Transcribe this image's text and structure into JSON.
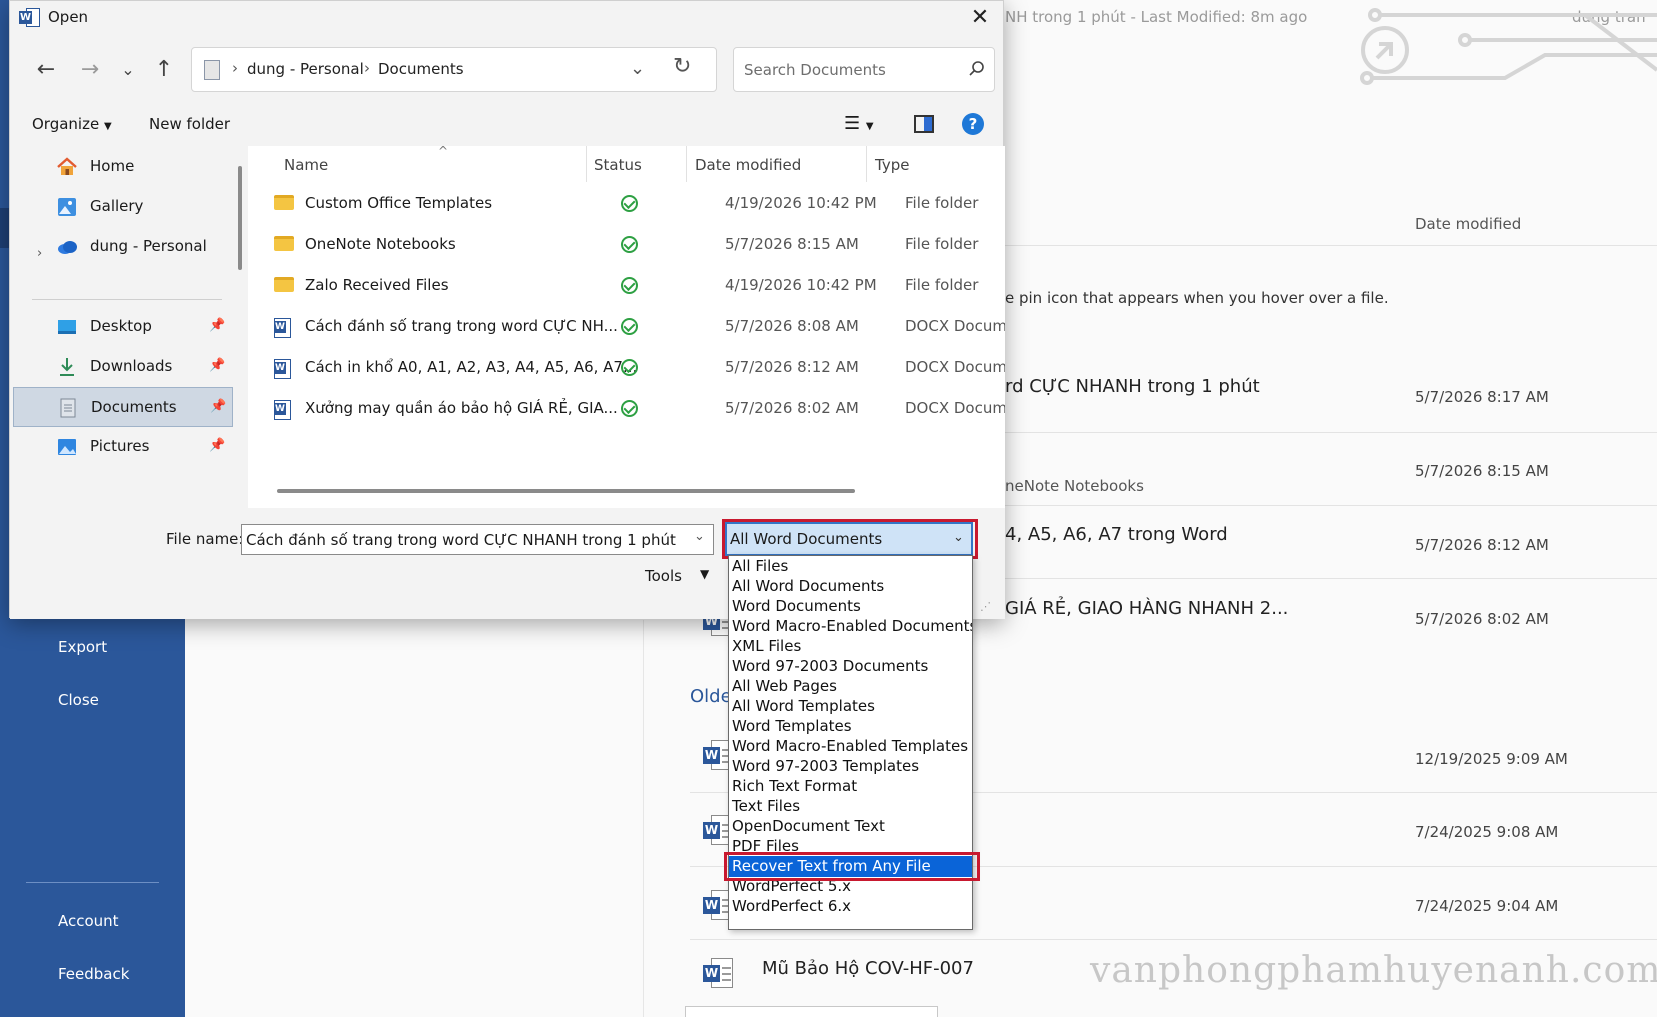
{
  "backstage": {
    "window_title": "NH trong 1 phút  -  Last Modified: 8m ago",
    "user": "dung tran",
    "nav": {
      "export": "Export",
      "close": "Close",
      "account": "Account",
      "feedback": "Feedback"
    },
    "list_header_date": "Date modified",
    "pin_hint": "e pin icon that appears when you hover over a file.",
    "rows": [
      {
        "title": "rd CỰC NHANH trong 1 phút",
        "sub": "",
        "date": "5/7/2026 8:17 AM"
      },
      {
        "title": "",
        "sub": "neNote Notebooks",
        "date": "5/7/2026 8:15 AM"
      },
      {
        "title": "4, A5, A6, A7 trong Word",
        "sub": "",
        "date": "5/7/2026 8:12 AM"
      },
      {
        "title": "GIÁ RẺ, GIAO HÀNG NHANH 2...",
        "sub": "",
        "date": "5/7/2026 8:02 AM"
      }
    ],
    "older_label": "Olde",
    "older_dates": [
      "12/19/2025 9:09 AM",
      "7/24/2025 9:08 AM",
      "7/24/2025 9:04 AM"
    ],
    "last_item_title": "Mũ Bảo Hộ COV-HF-007",
    "watermark": "vanphongphamhuyenanh.com"
  },
  "dialog": {
    "title": "Open",
    "address": {
      "crumbs": [
        "dung - Personal",
        "Documents"
      ]
    },
    "search_placeholder": "Search Documents",
    "toolbar": {
      "organize": "Organize",
      "new_folder": "New folder",
      "help": "?"
    },
    "nav_pane": [
      {
        "label": "Home",
        "icon": "home-icon",
        "pinned": false,
        "selected": false
      },
      {
        "label": "Gallery",
        "icon": "gallery-icon",
        "pinned": false,
        "selected": false
      },
      {
        "label": "dung - Personal",
        "icon": "onedrive-icon",
        "pinned": false,
        "selected": false
      },
      {
        "label": "Desktop",
        "icon": "desktop-icon",
        "pinned": true,
        "selected": false
      },
      {
        "label": "Downloads",
        "icon": "download-icon",
        "pinned": true,
        "selected": false
      },
      {
        "label": "Documents",
        "icon": "documents-icon",
        "pinned": true,
        "selected": true
      },
      {
        "label": "Pictures",
        "icon": "pictures-icon",
        "pinned": true,
        "selected": false
      }
    ],
    "columns": {
      "name": "Name",
      "status": "Status",
      "date": "Date modified",
      "type": "Type"
    },
    "files": [
      {
        "name": "Custom Office Templates",
        "kind": "folder",
        "date": "4/19/2026 10:42 PM",
        "type": "File folder"
      },
      {
        "name": "OneNote Notebooks",
        "kind": "folder",
        "date": "5/7/2026 8:15 AM",
        "type": "File folder"
      },
      {
        "name": "Zalo Received Files",
        "kind": "folder",
        "date": "4/19/2026 10:42 PM",
        "type": "File folder"
      },
      {
        "name": "Cách đánh số trang trong word CỰC NH...",
        "kind": "docx",
        "date": "5/7/2026 8:08 AM",
        "type": "DOCX Docum"
      },
      {
        "name": "Cách in khổ A0, A1, A2, A3, A4, A5, A6, A7...",
        "kind": "docx",
        "date": "5/7/2026 8:12 AM",
        "type": "DOCX Docum"
      },
      {
        "name": "Xưởng may quần áo bảo hộ GIÁ RẺ, GIA...",
        "kind": "docx",
        "date": "5/7/2026 8:02 AM",
        "type": "DOCX Docum"
      }
    ],
    "file_name_label": "File name:",
    "file_name_value": "Cách đánh số trang trong word CỰC NHANH trong 1 phút",
    "tools_label": "Tools",
    "filter": {
      "selected": "All Word Documents",
      "highlighted_option": "Recover Text from Any File",
      "options": [
        "All Files",
        "All Word Documents",
        "Word Documents",
        "Word Macro-Enabled Documents",
        "XML Files",
        "Word 97-2003 Documents",
        "All Web Pages",
        "All Word Templates",
        "Word Templates",
        "Word Macro-Enabled Templates",
        "Word 97-2003 Templates",
        "Rich Text Format",
        "Text Files",
        "OpenDocument Text",
        "PDF Files",
        "Recover Text from Any File",
        "WordPerfect 5.x",
        "WordPerfect 6.x"
      ]
    }
  },
  "colors": {
    "word_blue": "#2b579a",
    "highlight_red": "#c8192f",
    "selection_blue": "#0a64d8",
    "status_green": "#2ea043"
  }
}
